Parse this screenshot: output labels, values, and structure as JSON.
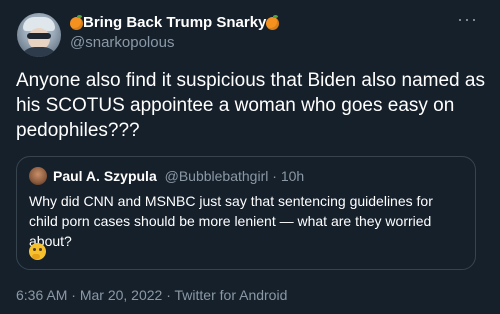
{
  "author": {
    "display_name": "Bring Back Trump Snarky",
    "handle": "@snarkopolous",
    "name_emoji": "orange-emoji"
  },
  "more_button": "···",
  "tweet": {
    "text": "Anyone also find it suspicious that Biden also named as his SCOTUS appointee a woman who goes easy on pedophiles???"
  },
  "quoted_tweet": {
    "display_name": "Paul A. Szypula",
    "handle": "@Bubblebathgirl",
    "separator": " · ",
    "time": "10h",
    "text": "Why did CNN and MSNBC just say that sentencing guidelines for child porn cases should be more lenient — what are they worried about?",
    "emoji": "thinking-face-emoji"
  },
  "footer": {
    "time": "6:36 AM",
    "separator1": " · ",
    "date": "Mar 20, 2022",
    "separator2": " · ",
    "source": "Twitter for Android"
  },
  "colors": {
    "background": "#15202b",
    "secondary_text": "#8b98a5",
    "border": "#38444d"
  }
}
